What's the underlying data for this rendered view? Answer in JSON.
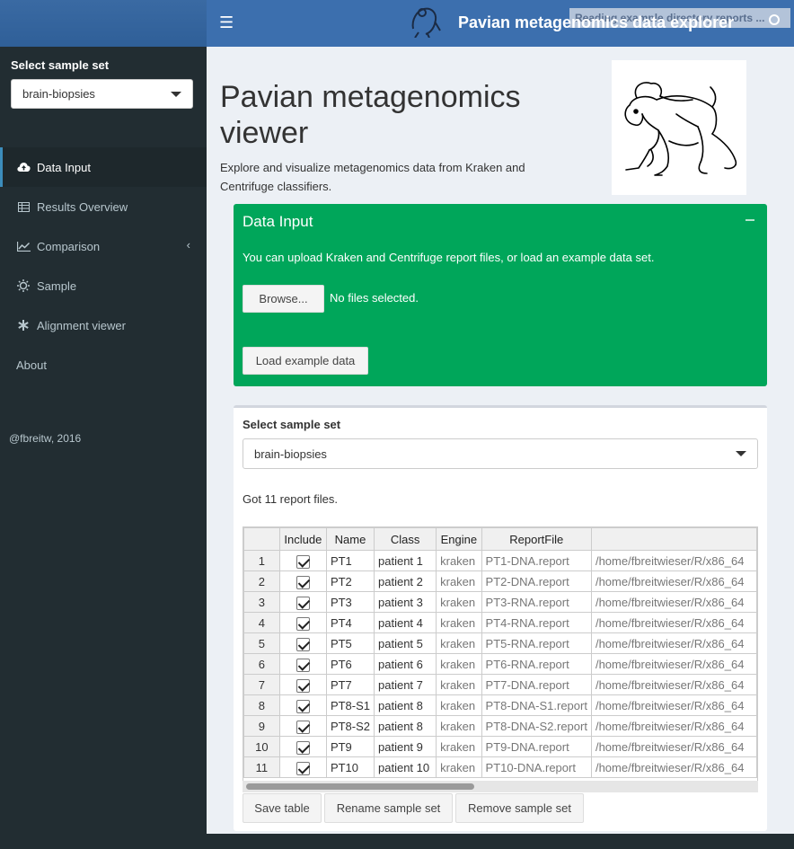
{
  "header": {
    "title": "Pavian metagenomics data explorer",
    "status_text": "Reading example directory reports ...",
    "menu_icon": "hamburger-icon",
    "github_icon": "github-icon"
  },
  "sidebar": {
    "select_label": "Select sample set",
    "select_value": "brain-biopsies",
    "items": [
      {
        "label": "Data Input",
        "icon": "cloud-upload-icon",
        "active": true
      },
      {
        "label": "Results Overview",
        "icon": "table-icon"
      },
      {
        "label": "Comparison",
        "icon": "line-chart-icon",
        "has_chevron": true
      },
      {
        "label": "Sample",
        "icon": "sun-icon"
      },
      {
        "label": "Alignment viewer",
        "icon": "asterisk-icon"
      },
      {
        "label": "About"
      }
    ],
    "footer": "@fbreitw, 2016"
  },
  "main": {
    "title": "Pavian metagenomics viewer",
    "description": "Explore and visualize metagenomics data from Kraken and Centrifuge classifiers.",
    "data_input_box": {
      "title": "Data Input",
      "text": "You can upload Kraken and Centrifuge report files, or load an example data set.",
      "browse_label": "Browse...",
      "no_files": "No files selected.",
      "load_example_label": "Load example data"
    },
    "sample_set_box": {
      "label": "Select sample set",
      "value": "brain-biopsies",
      "report_count_text": "Got 11 report files.",
      "table": {
        "columns": [
          "",
          "Include",
          "Name",
          "Class",
          "Engine",
          "ReportFile",
          ""
        ],
        "rows": [
          [
            "1",
            true,
            "PT1",
            "patient 1",
            "kraken",
            "PT1-DNA.report",
            "/home/fbreitwieser/R/x86_64"
          ],
          [
            "2",
            true,
            "PT2",
            "patient 2",
            "kraken",
            "PT2-DNA.report",
            "/home/fbreitwieser/R/x86_64"
          ],
          [
            "3",
            true,
            "PT3",
            "patient 3",
            "kraken",
            "PT3-RNA.report",
            "/home/fbreitwieser/R/x86_64"
          ],
          [
            "4",
            true,
            "PT4",
            "patient 4",
            "kraken",
            "PT4-RNA.report",
            "/home/fbreitwieser/R/x86_64"
          ],
          [
            "5",
            true,
            "PT5",
            "patient 5",
            "kraken",
            "PT5-RNA.report",
            "/home/fbreitwieser/R/x86_64"
          ],
          [
            "6",
            true,
            "PT6",
            "patient 6",
            "kraken",
            "PT6-RNA.report",
            "/home/fbreitwieser/R/x86_64"
          ],
          [
            "7",
            true,
            "PT7",
            "patient 7",
            "kraken",
            "PT7-DNA.report",
            "/home/fbreitwieser/R/x86_64"
          ],
          [
            "8",
            true,
            "PT8-S1",
            "patient 8",
            "kraken",
            "PT8-DNA-S1.report",
            "/home/fbreitwieser/R/x86_64"
          ],
          [
            "9",
            true,
            "PT8-S2",
            "patient 8",
            "kraken",
            "PT8-DNA-S2.report",
            "/home/fbreitwieser/R/x86_64"
          ],
          [
            "10",
            true,
            "PT9",
            "patient 9",
            "kraken",
            "PT9-DNA.report",
            "/home/fbreitwieser/R/x86_64"
          ],
          [
            "11",
            true,
            "PT10",
            "patient 10",
            "kraken",
            "PT10-DNA.report",
            "/home/fbreitwieser/R/x86_64"
          ]
        ]
      },
      "buttons": {
        "save": "Save table",
        "rename": "Rename sample set",
        "remove": "Remove sample set"
      }
    }
  }
}
